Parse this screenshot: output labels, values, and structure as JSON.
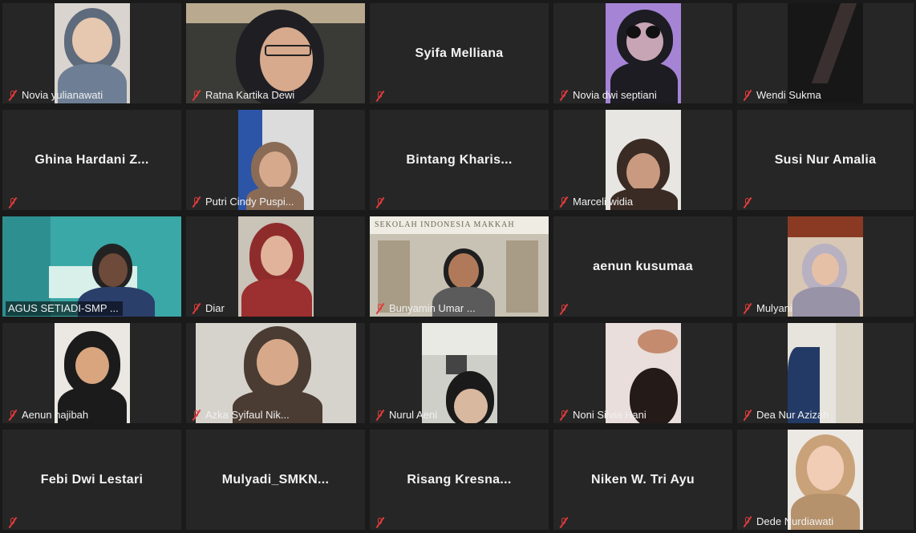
{
  "participants": [
    {
      "name": "Novia yulianawati",
      "video": true
    },
    {
      "name": "Ratna Kartika Dewi",
      "video": true
    },
    {
      "name": "Syifa Melliana",
      "video": false
    },
    {
      "name": "Novia dwi septiani",
      "video": true
    },
    {
      "name": "Wendi Sukma",
      "video": true
    },
    {
      "name": "Ghina Hardani Z...",
      "video": false
    },
    {
      "name": "Putri Cindy Puspi...",
      "video": true
    },
    {
      "name": "Bintang Kharis...",
      "video": false
    },
    {
      "name": "Marceli widia",
      "video": true
    },
    {
      "name": "Susi Nur Amalia",
      "video": false
    },
    {
      "name": "AGUS SETIADI-SMP ...",
      "video": true,
      "active_speaker": true
    },
    {
      "name": "Diar",
      "video": true
    },
    {
      "name": "Bunyamin Umar ...",
      "video": true,
      "background_text": "SEKOLAH INDONESIA MAKKAH"
    },
    {
      "name": "aenun kusumaa",
      "video": false
    },
    {
      "name": "Mulyani",
      "video": true
    },
    {
      "name": "Aenun najibah",
      "video": true
    },
    {
      "name": "Azka Syifaul Nik...",
      "video": true
    },
    {
      "name": "Nurul Aeni",
      "video": true
    },
    {
      "name": "Noni Silvia Hani",
      "video": true
    },
    {
      "name": "Dea Nur Azizah",
      "video": true
    },
    {
      "name": "Febi Dwi Lestari",
      "video": false
    },
    {
      "name": "Mulyadi_SMKN...",
      "video": false
    },
    {
      "name": "Risang Kresna...",
      "video": false
    },
    {
      "name": "Niken W. Tri Ayu",
      "video": false
    },
    {
      "name": "Dede Nurdiawati",
      "video": true
    }
  ],
  "colors": {
    "background": "#1a1a1a",
    "tile": "#262626",
    "active_speaker_border": "#c9d94b",
    "mute_icon": "#e03b3b"
  }
}
